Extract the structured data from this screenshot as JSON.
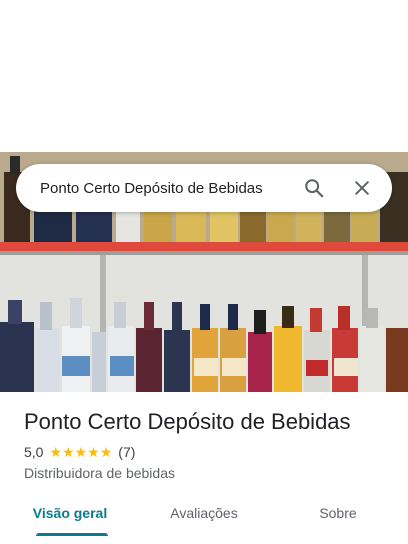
{
  "search": {
    "query": "Ponto Certo Depósito de Bebidas",
    "search_icon": "search-icon",
    "close_icon": "close-icon"
  },
  "photo": {
    "subject": "store-shelves-with-bottles"
  },
  "place": {
    "name": "Ponto Certo Depósito de Bebidas",
    "rating": "5,0",
    "stars": 5,
    "review_count": "(7)",
    "category": "Distribuidora de bebidas"
  },
  "tabs": [
    {
      "label": "Visão geral",
      "active": true
    },
    {
      "label": "Avaliações",
      "active": false
    },
    {
      "label": "Sobre",
      "active": false
    }
  ],
  "colors": {
    "accent": "#0b7b8b",
    "star": "#fbbc04",
    "shelf": "#e04a3c"
  }
}
